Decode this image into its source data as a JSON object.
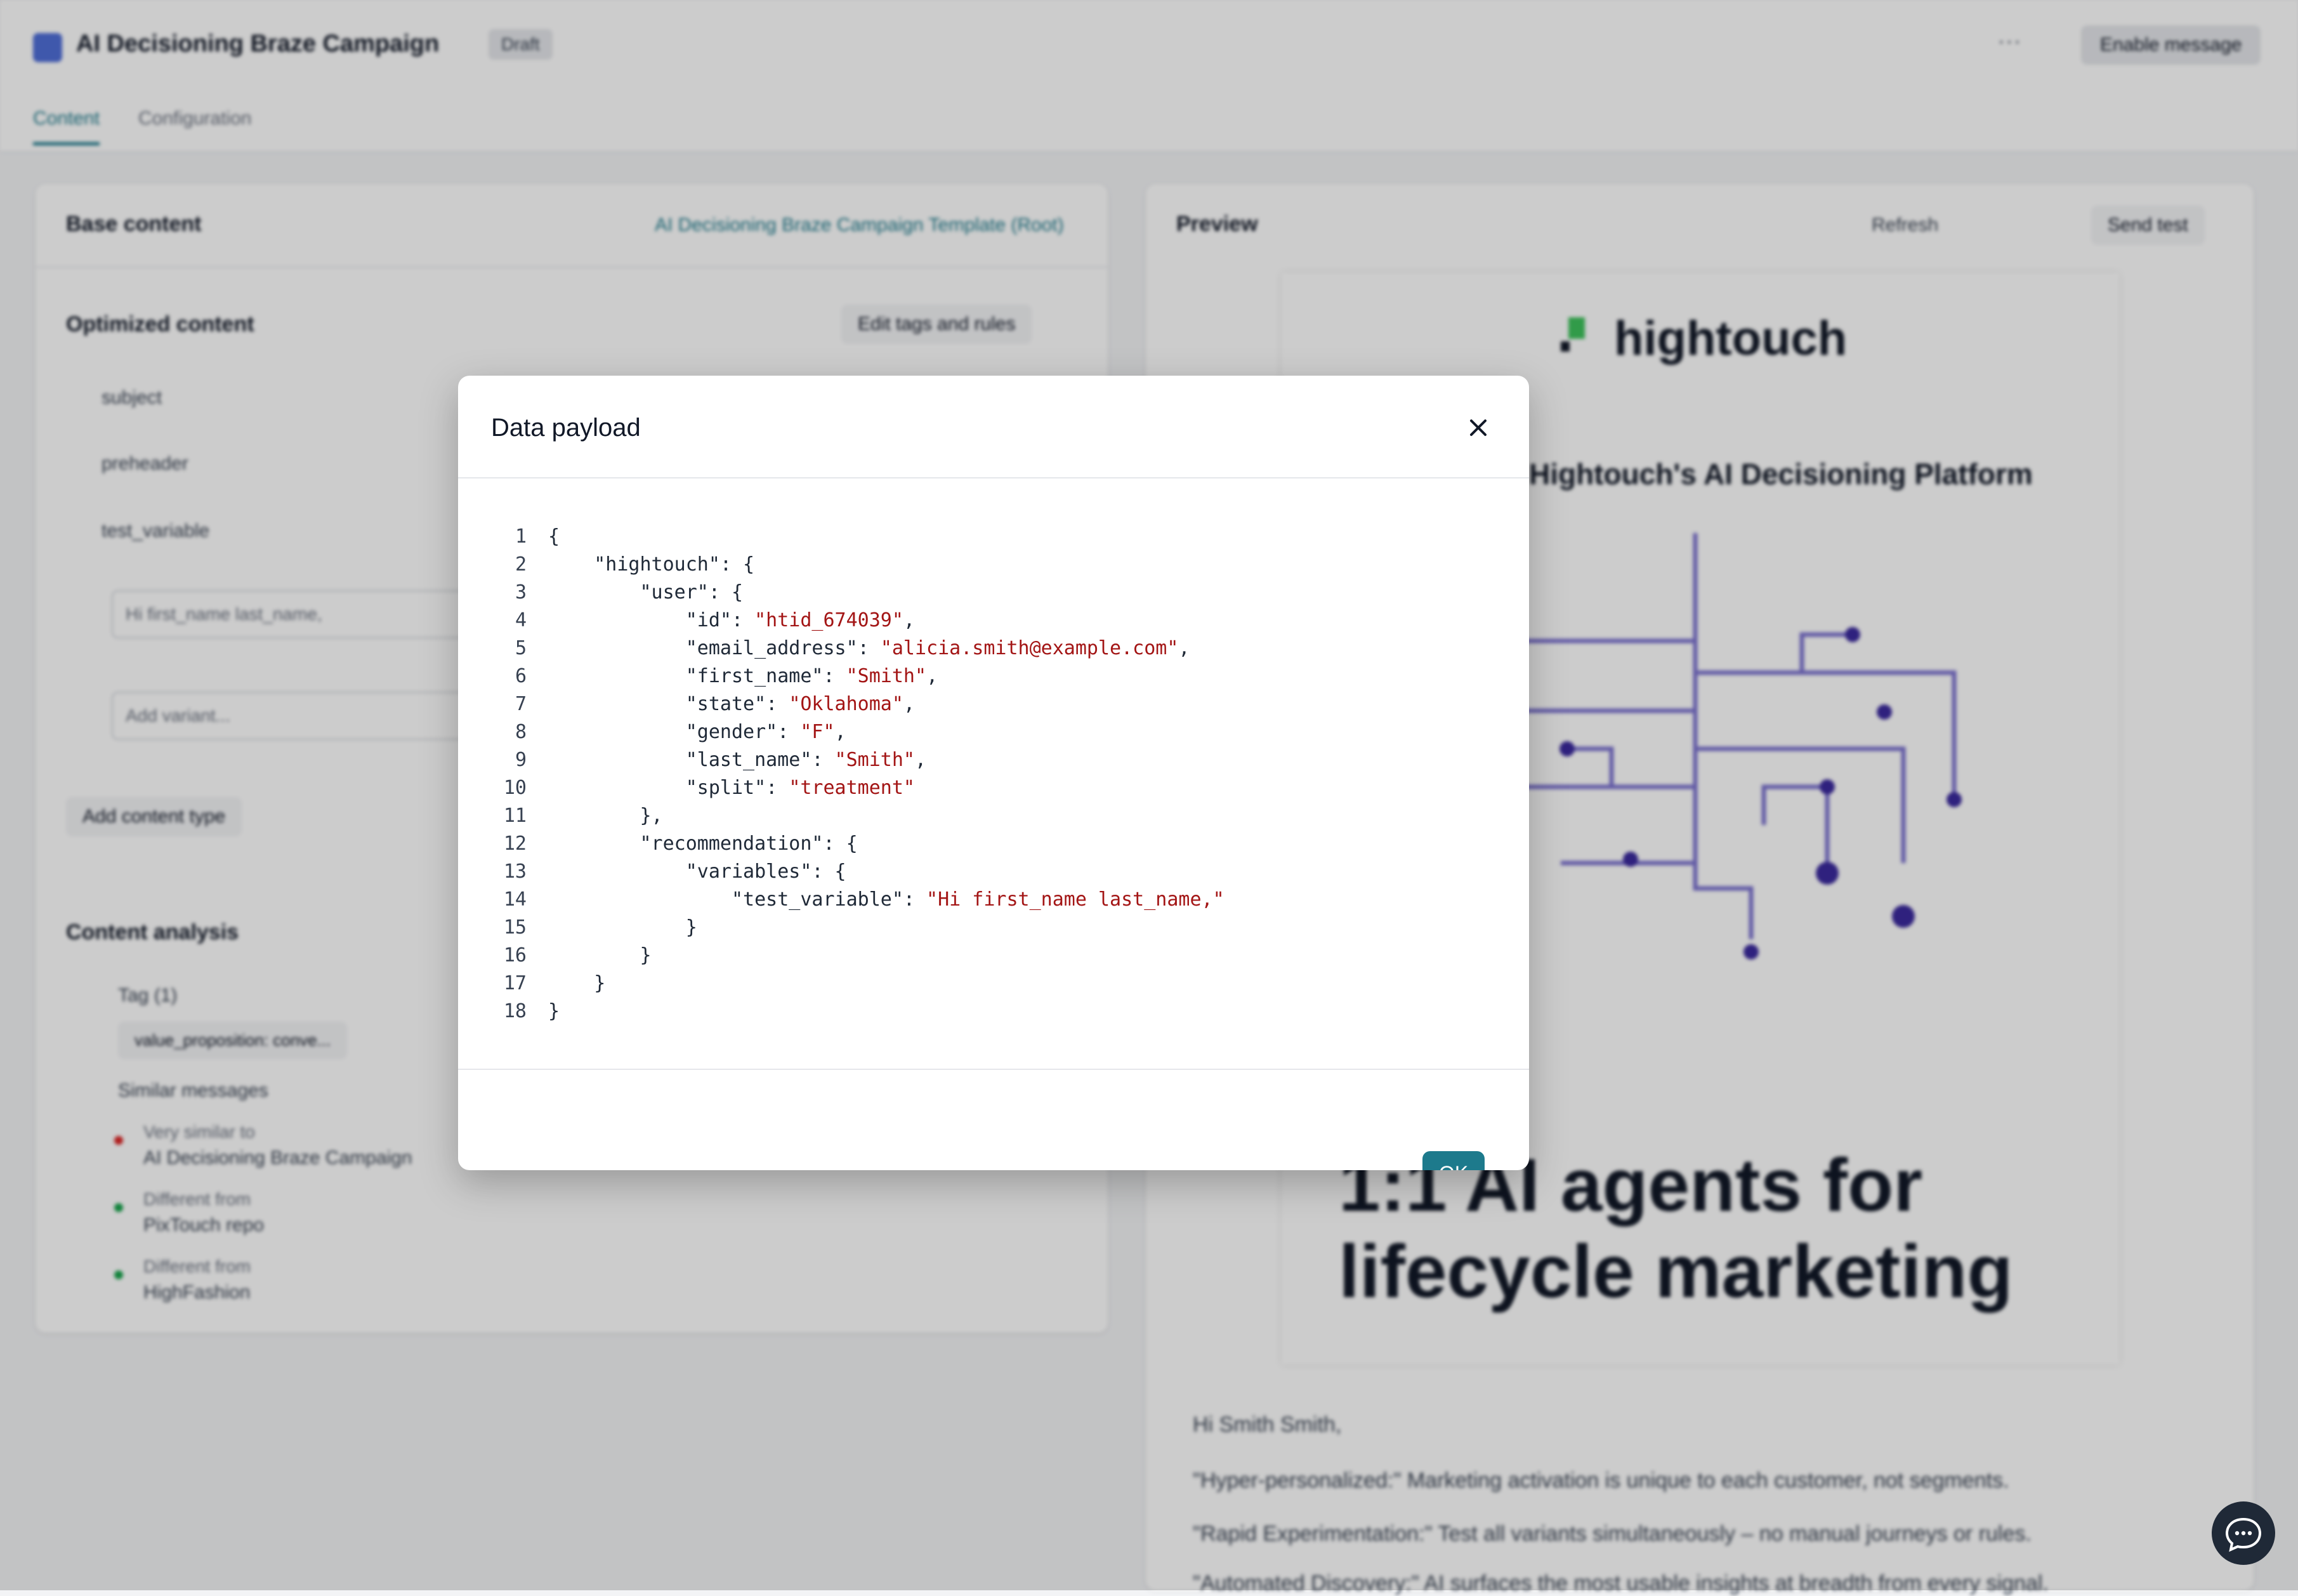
{
  "header": {
    "title": "AI Decisioning Braze Campaign",
    "status": "Draft",
    "more_label": "···",
    "enable_label": "Enable message"
  },
  "tabs": [
    {
      "label": "Content"
    },
    {
      "label": "Configuration"
    }
  ],
  "left_panel": {
    "base_content_title": "Base content",
    "template_link": "AI Decisioning Braze Campaign Template (Root)",
    "optimized_title": "Optimized content",
    "edit_tags_label": "Edit tags and rules",
    "rows": [
      "subject",
      "preheader",
      "test_variable"
    ],
    "variant_value": "Hi first_name last_name,",
    "add_variant_placeholder": "Add variant...",
    "add_content_type_label": "Add content type",
    "analysis_title": "Content analysis",
    "tag_label": "Tag (1)",
    "tag_value": "value_proposition: conve...",
    "similar_title": "Similar messages",
    "similar_items": [
      {
        "relation": "Very similar to",
        "name": "AI Decisioning Braze Campaign",
        "color": "#dc2626"
      },
      {
        "relation": "Different from",
        "name": "PixTouch repo",
        "color": "#16a34a"
      },
      {
        "relation": "Different from",
        "name": "HighFashion",
        "color": "#16a34a"
      }
    ]
  },
  "right_panel": {
    "title": "Preview",
    "refresh_label": "Refresh",
    "send_test_label": "Send test",
    "logo_text": "hightouch",
    "email_heading": "Hightouch's AI Decisioning Platform",
    "big_heading_line1": "1:1 AI agents for",
    "big_heading_line2": "lifecycle marketing",
    "bullets": [
      "Hi Smith Smith,",
      "\"Hyper-personalized:\" Marketing activation is unique to each customer, not segments.",
      "\"Rapid Experimentation:\" Test all variants simultaneously – no manual journeys or rules.",
      "\"Automated Discovery:\" AI surfaces the most usable insights at breadth from every signal."
    ]
  },
  "modal": {
    "title": "Data payload",
    "ok_label": "OK",
    "code_lines": [
      {
        "n": "1",
        "indent": 0,
        "tokens": [
          {
            "t": "{",
            "k": "punc"
          }
        ]
      },
      {
        "n": "2",
        "indent": 1,
        "tokens": [
          {
            "t": "\"hightouch\"",
            "k": "key"
          },
          {
            "t": ": {",
            "k": "punc"
          }
        ]
      },
      {
        "n": "3",
        "indent": 2,
        "tokens": [
          {
            "t": "\"user\"",
            "k": "key"
          },
          {
            "t": ": {",
            "k": "punc"
          }
        ]
      },
      {
        "n": "4",
        "indent": 3,
        "tokens": [
          {
            "t": "\"id\"",
            "k": "key"
          },
          {
            "t": ": ",
            "k": "punc"
          },
          {
            "t": "\"htid_674039\"",
            "k": "str"
          },
          {
            "t": ",",
            "k": "punc"
          }
        ]
      },
      {
        "n": "5",
        "indent": 3,
        "tokens": [
          {
            "t": "\"email_address\"",
            "k": "key"
          },
          {
            "t": ": ",
            "k": "punc"
          },
          {
            "t": "\"alicia.smith@example.com\"",
            "k": "str"
          },
          {
            "t": ",",
            "k": "punc"
          }
        ]
      },
      {
        "n": "6",
        "indent": 3,
        "tokens": [
          {
            "t": "\"first_name\"",
            "k": "key"
          },
          {
            "t": ": ",
            "k": "punc"
          },
          {
            "t": "\"Smith\"",
            "k": "str"
          },
          {
            "t": ",",
            "k": "punc"
          }
        ]
      },
      {
        "n": "7",
        "indent": 3,
        "tokens": [
          {
            "t": "\"state\"",
            "k": "key"
          },
          {
            "t": ": ",
            "k": "punc"
          },
          {
            "t": "\"Oklahoma\"",
            "k": "str"
          },
          {
            "t": ",",
            "k": "punc"
          }
        ]
      },
      {
        "n": "8",
        "indent": 3,
        "tokens": [
          {
            "t": "\"gender\"",
            "k": "key"
          },
          {
            "t": ": ",
            "k": "punc"
          },
          {
            "t": "\"F\"",
            "k": "str"
          },
          {
            "t": ",",
            "k": "punc"
          }
        ]
      },
      {
        "n": "9",
        "indent": 3,
        "tokens": [
          {
            "t": "\"last_name\"",
            "k": "key"
          },
          {
            "t": ": ",
            "k": "punc"
          },
          {
            "t": "\"Smith\"",
            "k": "str"
          },
          {
            "t": ",",
            "k": "punc"
          }
        ]
      },
      {
        "n": "10",
        "indent": 3,
        "tokens": [
          {
            "t": "\"split\"",
            "k": "key"
          },
          {
            "t": ": ",
            "k": "punc"
          },
          {
            "t": "\"treatment\"",
            "k": "str"
          }
        ]
      },
      {
        "n": "11",
        "indent": 2,
        "tokens": [
          {
            "t": "},",
            "k": "punc"
          }
        ]
      },
      {
        "n": "12",
        "indent": 2,
        "tokens": [
          {
            "t": "\"recommendation\"",
            "k": "key"
          },
          {
            "t": ": {",
            "k": "punc"
          }
        ]
      },
      {
        "n": "13",
        "indent": 3,
        "tokens": [
          {
            "t": "\"variables\"",
            "k": "key"
          },
          {
            "t": ": {",
            "k": "punc"
          }
        ]
      },
      {
        "n": "14",
        "indent": 4,
        "tokens": [
          {
            "t": "\"test_variable\"",
            "k": "key"
          },
          {
            "t": ": ",
            "k": "punc"
          },
          {
            "t": "\"Hi first_name last_name,\"",
            "k": "str"
          }
        ]
      },
      {
        "n": "15",
        "indent": 3,
        "tokens": [
          {
            "t": "}",
            "k": "punc"
          }
        ]
      },
      {
        "n": "16",
        "indent": 2,
        "tokens": [
          {
            "t": "}",
            "k": "punc"
          }
        ]
      },
      {
        "n": "17",
        "indent": 1,
        "tokens": [
          {
            "t": "}",
            "k": "punc"
          }
        ]
      },
      {
        "n": "18",
        "indent": 0,
        "tokens": [
          {
            "t": "}",
            "k": "punc"
          }
        ]
      }
    ]
  },
  "colors": {
    "accent": "#1d7a8c",
    "json_string": "#a31515",
    "graph_line": "#5b4fc4"
  }
}
